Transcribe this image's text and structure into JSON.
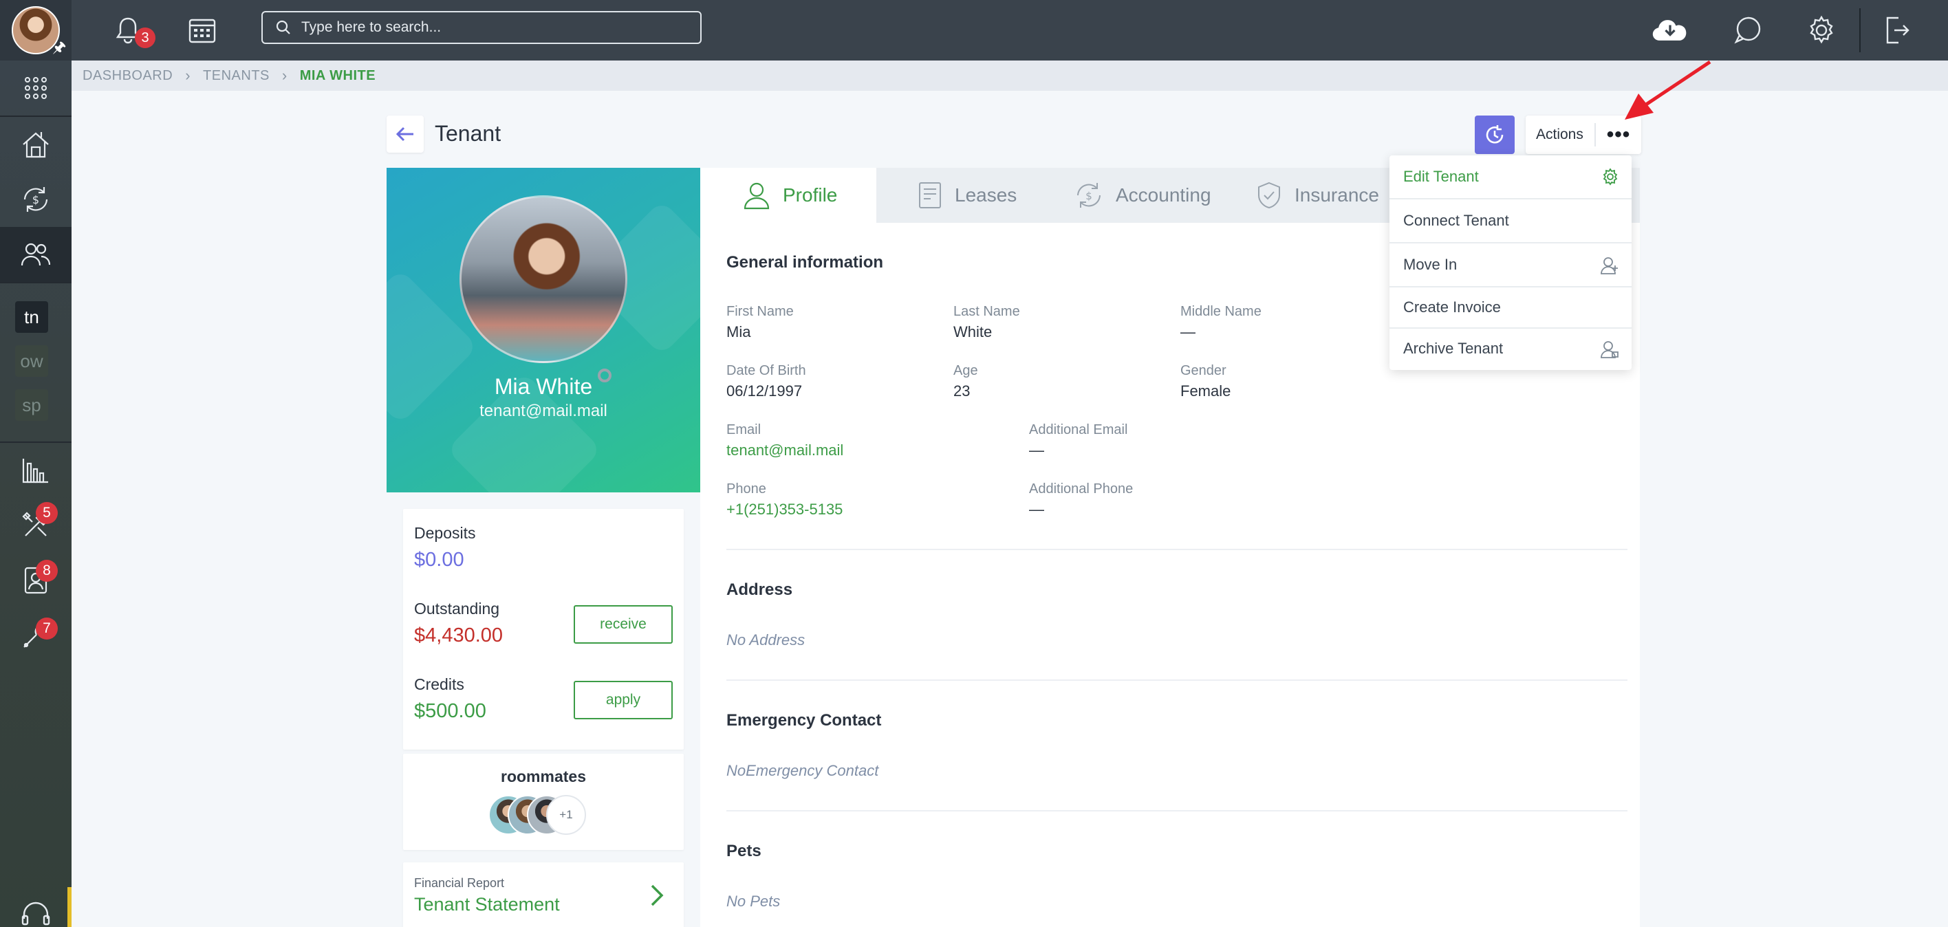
{
  "topbar": {
    "notifications_count": "3",
    "search_placeholder": "Type here to search..."
  },
  "sidebar": {
    "letters": [
      "tn",
      "ow",
      "sp"
    ],
    "badges": {
      "tools": "5",
      "contacts": "8",
      "wrench": "7"
    }
  },
  "breadcrumb": [
    "DASHBOARD",
    "TENANTS",
    "MIA WHITE"
  ],
  "page": {
    "title": "Tenant"
  },
  "actions": {
    "label": "Actions",
    "more": "•••"
  },
  "menu": {
    "items": [
      "Edit Tenant",
      "Connect Tenant",
      "Move In",
      "Create Invoice",
      "Archive Tenant"
    ]
  },
  "profile": {
    "name": "Mia White",
    "email": "tenant@mail.mail"
  },
  "finance": {
    "deposits_label": "Deposits",
    "deposits_value": "$0.00",
    "outstanding_label": "Outstanding",
    "outstanding_value": "$4,430.00",
    "receive_label": "receive",
    "credits_label": "Credits",
    "credits_value": "$500.00",
    "apply_label": "apply"
  },
  "roommates": {
    "title": "roommates",
    "more": "+1"
  },
  "report": {
    "small": "Financial Report",
    "title": "Tenant Statement"
  },
  "tabs": [
    "Profile",
    "Leases",
    "Accounting",
    "Insurance"
  ],
  "general": {
    "title": "General information",
    "first_name_label": "First Name",
    "first_name": "Mia",
    "last_name_label": "Last Name",
    "last_name": "White",
    "middle_name_label": "Middle Name",
    "middle_name": "—",
    "dob_label": "Date Of Birth",
    "dob": "06/12/1997",
    "age_label": "Age",
    "age": "23",
    "gender_label": "Gender",
    "gender": "Female",
    "email_label": "Email",
    "email": "tenant@mail.mail",
    "add_email_label": "Additional Email",
    "add_email": "—",
    "phone_label": "Phone",
    "phone": "+1(251)353-5135",
    "add_phone_label": "Additional Phone",
    "add_phone": "—"
  },
  "address": {
    "title": "Address",
    "empty": "No Address"
  },
  "emergency": {
    "title": "Emergency Contact",
    "empty": "NoEmergency Contact"
  },
  "pets": {
    "title": "Pets",
    "empty": "No Pets"
  },
  "colors": {
    "primary_green": "#3c9c46",
    "danger_red": "#c4302b",
    "accent_purple": "#6c6fe0",
    "topbar": "#3a434c"
  }
}
